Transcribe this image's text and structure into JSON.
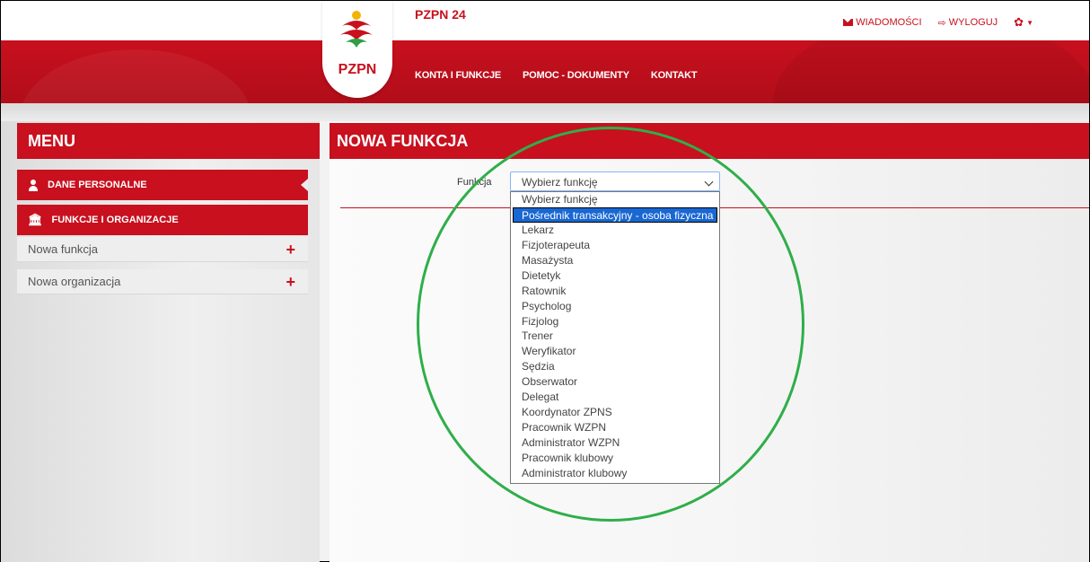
{
  "header": {
    "brand": "PZPN 24",
    "logo_text": "PZPN",
    "nav": [
      "KONTA I FUNKCJE",
      "POMOC - DOKUMENTY",
      "KONTAKT"
    ],
    "messages_label": "WIADOMOŚCI",
    "logout_label": "WYLOGUJ"
  },
  "sidebar": {
    "title": "MENU",
    "sections": [
      {
        "label": "DANE PERSONALNE",
        "icon": "person-icon"
      },
      {
        "label": "FUNKCJE I ORGANIZACJE",
        "icon": "bank-icon"
      }
    ],
    "items": [
      {
        "label": "Nowa funkcja"
      },
      {
        "label": "Nowa organizacja"
      }
    ]
  },
  "main": {
    "title": "NOWA FUNKCJA",
    "field_label": "Funkcja",
    "select_value": "Wybierz funkcję",
    "options": [
      "Wybierz funkcję",
      "Pośrednik transakcyjny - osoba fizyczna",
      "Lekarz",
      "Fizjoterapeuta",
      "Masażysta",
      "Dietetyk",
      "Ratownik",
      "Psycholog",
      "Fizjolog",
      "Trener",
      "Weryfikator",
      "Sędzia",
      "Obserwator",
      "Delegat",
      "Koordynator ZPNS",
      "Pracownik WZPN",
      "Administrator WZPN",
      "Pracownik klubowy",
      "Administrator klubowy"
    ],
    "highlighted_option": "Pośrednik transakcyjny - osoba fizyczna"
  },
  "colors": {
    "brand_red": "#c8101e",
    "highlight_blue": "#1967d2",
    "annotation_green": "#2fae4a"
  }
}
